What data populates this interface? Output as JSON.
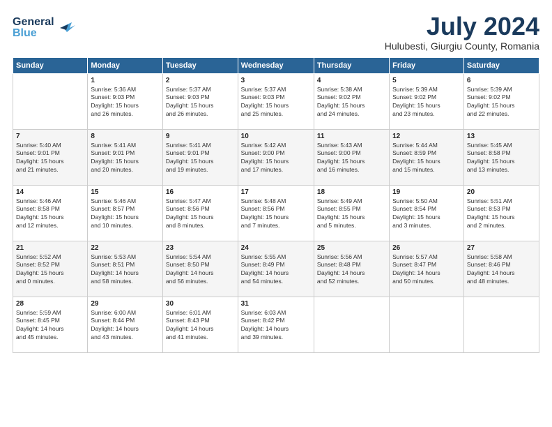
{
  "header": {
    "logo_line1": "General",
    "logo_line2": "Blue",
    "month_year": "July 2024",
    "location": "Hulubesti, Giurgiu County, Romania"
  },
  "days_of_week": [
    "Sunday",
    "Monday",
    "Tuesday",
    "Wednesday",
    "Thursday",
    "Friday",
    "Saturday"
  ],
  "weeks": [
    [
      {
        "day": "",
        "info": ""
      },
      {
        "day": "1",
        "info": "Sunrise: 5:36 AM\nSunset: 9:03 PM\nDaylight: 15 hours\nand 26 minutes."
      },
      {
        "day": "2",
        "info": "Sunrise: 5:37 AM\nSunset: 9:03 PM\nDaylight: 15 hours\nand 26 minutes."
      },
      {
        "day": "3",
        "info": "Sunrise: 5:37 AM\nSunset: 9:03 PM\nDaylight: 15 hours\nand 25 minutes."
      },
      {
        "day": "4",
        "info": "Sunrise: 5:38 AM\nSunset: 9:02 PM\nDaylight: 15 hours\nand 24 minutes."
      },
      {
        "day": "5",
        "info": "Sunrise: 5:39 AM\nSunset: 9:02 PM\nDaylight: 15 hours\nand 23 minutes."
      },
      {
        "day": "6",
        "info": "Sunrise: 5:39 AM\nSunset: 9:02 PM\nDaylight: 15 hours\nand 22 minutes."
      }
    ],
    [
      {
        "day": "7",
        "info": "Sunrise: 5:40 AM\nSunset: 9:01 PM\nDaylight: 15 hours\nand 21 minutes."
      },
      {
        "day": "8",
        "info": "Sunrise: 5:41 AM\nSunset: 9:01 PM\nDaylight: 15 hours\nand 20 minutes."
      },
      {
        "day": "9",
        "info": "Sunrise: 5:41 AM\nSunset: 9:01 PM\nDaylight: 15 hours\nand 19 minutes."
      },
      {
        "day": "10",
        "info": "Sunrise: 5:42 AM\nSunset: 9:00 PM\nDaylight: 15 hours\nand 17 minutes."
      },
      {
        "day": "11",
        "info": "Sunrise: 5:43 AM\nSunset: 9:00 PM\nDaylight: 15 hours\nand 16 minutes."
      },
      {
        "day": "12",
        "info": "Sunrise: 5:44 AM\nSunset: 8:59 PM\nDaylight: 15 hours\nand 15 minutes."
      },
      {
        "day": "13",
        "info": "Sunrise: 5:45 AM\nSunset: 8:58 PM\nDaylight: 15 hours\nand 13 minutes."
      }
    ],
    [
      {
        "day": "14",
        "info": "Sunrise: 5:46 AM\nSunset: 8:58 PM\nDaylight: 15 hours\nand 12 minutes."
      },
      {
        "day": "15",
        "info": "Sunrise: 5:46 AM\nSunset: 8:57 PM\nDaylight: 15 hours\nand 10 minutes."
      },
      {
        "day": "16",
        "info": "Sunrise: 5:47 AM\nSunset: 8:56 PM\nDaylight: 15 hours\nand 8 minutes."
      },
      {
        "day": "17",
        "info": "Sunrise: 5:48 AM\nSunset: 8:56 PM\nDaylight: 15 hours\nand 7 minutes."
      },
      {
        "day": "18",
        "info": "Sunrise: 5:49 AM\nSunset: 8:55 PM\nDaylight: 15 hours\nand 5 minutes."
      },
      {
        "day": "19",
        "info": "Sunrise: 5:50 AM\nSunset: 8:54 PM\nDaylight: 15 hours\nand 3 minutes."
      },
      {
        "day": "20",
        "info": "Sunrise: 5:51 AM\nSunset: 8:53 PM\nDaylight: 15 hours\nand 2 minutes."
      }
    ],
    [
      {
        "day": "21",
        "info": "Sunrise: 5:52 AM\nSunset: 8:52 PM\nDaylight: 15 hours\nand 0 minutes."
      },
      {
        "day": "22",
        "info": "Sunrise: 5:53 AM\nSunset: 8:51 PM\nDaylight: 14 hours\nand 58 minutes."
      },
      {
        "day": "23",
        "info": "Sunrise: 5:54 AM\nSunset: 8:50 PM\nDaylight: 14 hours\nand 56 minutes."
      },
      {
        "day": "24",
        "info": "Sunrise: 5:55 AM\nSunset: 8:49 PM\nDaylight: 14 hours\nand 54 minutes."
      },
      {
        "day": "25",
        "info": "Sunrise: 5:56 AM\nSunset: 8:48 PM\nDaylight: 14 hours\nand 52 minutes."
      },
      {
        "day": "26",
        "info": "Sunrise: 5:57 AM\nSunset: 8:47 PM\nDaylight: 14 hours\nand 50 minutes."
      },
      {
        "day": "27",
        "info": "Sunrise: 5:58 AM\nSunset: 8:46 PM\nDaylight: 14 hours\nand 48 minutes."
      }
    ],
    [
      {
        "day": "28",
        "info": "Sunrise: 5:59 AM\nSunset: 8:45 PM\nDaylight: 14 hours\nand 45 minutes."
      },
      {
        "day": "29",
        "info": "Sunrise: 6:00 AM\nSunset: 8:44 PM\nDaylight: 14 hours\nand 43 minutes."
      },
      {
        "day": "30",
        "info": "Sunrise: 6:01 AM\nSunset: 8:43 PM\nDaylight: 14 hours\nand 41 minutes."
      },
      {
        "day": "31",
        "info": "Sunrise: 6:03 AM\nSunset: 8:42 PM\nDaylight: 14 hours\nand 39 minutes."
      },
      {
        "day": "",
        "info": ""
      },
      {
        "day": "",
        "info": ""
      },
      {
        "day": "",
        "info": ""
      }
    ]
  ]
}
